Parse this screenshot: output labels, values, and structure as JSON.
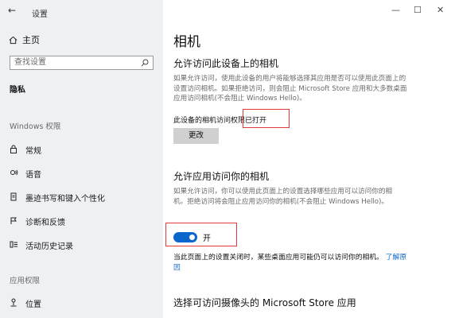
{
  "window": {
    "title": "设置",
    "back_icon": "←",
    "minimize": "—",
    "maximize": "☐",
    "close": "✕"
  },
  "sidebar": {
    "home_label": "主页",
    "search_placeholder": "查找设置",
    "current_section": "隐私",
    "windows_perms_header": "Windows 权限",
    "windows_items": [
      {
        "label": "常规",
        "icon": "lock-icon"
      },
      {
        "label": "语音",
        "icon": "speech-icon"
      },
      {
        "label": "墨迹书写和键入个性化",
        "icon": "inking-icon"
      },
      {
        "label": "诊断和反馈",
        "icon": "feedback-icon"
      },
      {
        "label": "活动历史记录",
        "icon": "activity-history-icon"
      }
    ],
    "app_perms_header": "应用权限",
    "app_items": [
      {
        "label": "位置",
        "icon": "location-icon"
      }
    ]
  },
  "main": {
    "page_title": "相机",
    "device_section": {
      "heading": "允许访问此设备上的相机",
      "description": "如果允许访问，使用此设备的用户将能够选择其应用是否可以使用此页面上的设置访问相机。如果拒绝访问，则会阻止 Microsoft Store 应用和大多数桌面应用访问相机(不会阻止 Windows Hello)。",
      "status_prefix": "此设备的相机访问权",
      "status_value": "限已打开",
      "change_button": "更改"
    },
    "app_section": {
      "heading": "允许应用访问你的相机",
      "description": "如果允许访问，你可以使用此页面上的设置选择哪些应用可以访问你的相机。拒绝访问将会阻止应用访问你的相机(不会阻止 Windows Hello)。",
      "toggle_state": "开",
      "toggle_on": true,
      "note": "当此页面上的设置关闭时，某些桌面应用可能仍可以访问你的相机。",
      "learn_more": "了解原因"
    },
    "store_section": {
      "heading": "选择可访问摄像头的 Microsoft Store 应用"
    }
  },
  "colors": {
    "accent": "#0a66cc",
    "annotation": "#e03a3a",
    "sidebar_bg": "#eef0f4"
  }
}
